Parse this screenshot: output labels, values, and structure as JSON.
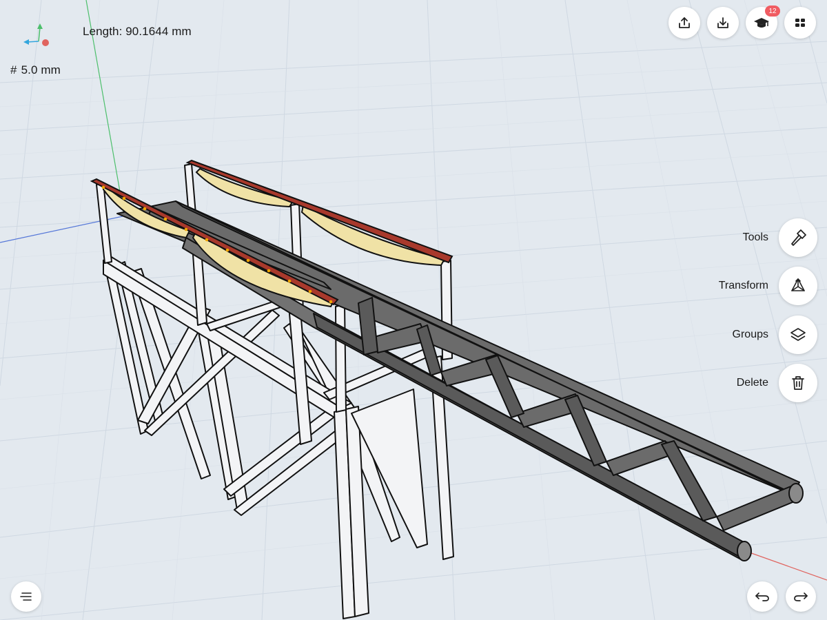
{
  "readouts": {
    "length": "Length: 90.1644 mm",
    "grid_glyph": "#",
    "grid_size": "5.0 mm"
  },
  "top_toolbar": {
    "icons": [
      "export-icon",
      "import-icon",
      "learn-icon",
      "apps-grid-icon"
    ],
    "learn_badge": "12"
  },
  "side_menu": {
    "items": [
      {
        "label": "Tools",
        "icon": "hammer-icon"
      },
      {
        "label": "Transform",
        "icon": "transform-icon"
      },
      {
        "label": "Groups",
        "icon": "layers-icon"
      },
      {
        "label": "Delete",
        "icon": "trash-icon"
      }
    ]
  },
  "bottom_bar": {
    "icons": [
      "menu-icon",
      "undo-icon",
      "redo-icon"
    ]
  },
  "colors": {
    "background": "#e3e9ef",
    "grid_line": "#c9d3de",
    "axis_x": "#e0645f",
    "axis_y": "#4cbf6b",
    "axis_z": "#5577d8",
    "badge": "#f05c62",
    "truss": "#6b6b6b",
    "frame": "#f3f4f6",
    "panel": "#f0e2a6",
    "rail": "#a8392c",
    "bolt": "#f0a500"
  }
}
